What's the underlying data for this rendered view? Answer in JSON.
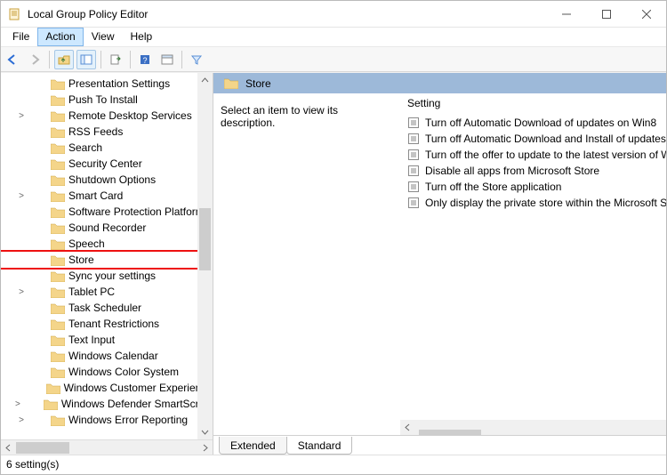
{
  "window": {
    "title": "Local Group Policy Editor"
  },
  "menu": {
    "file": "File",
    "action": "Action",
    "view": "View",
    "help": "Help"
  },
  "tree": {
    "items": [
      {
        "label": "Presentation Settings",
        "expand": ""
      },
      {
        "label": "Push To Install",
        "expand": ""
      },
      {
        "label": "Remote Desktop Services",
        "expand": ">"
      },
      {
        "label": "RSS Feeds",
        "expand": ""
      },
      {
        "label": "Search",
        "expand": ""
      },
      {
        "label": "Security Center",
        "expand": ""
      },
      {
        "label": "Shutdown Options",
        "expand": ""
      },
      {
        "label": "Smart Card",
        "expand": ">"
      },
      {
        "label": "Software Protection Platform",
        "expand": ""
      },
      {
        "label": "Sound Recorder",
        "expand": ""
      },
      {
        "label": "Speech",
        "expand": ""
      },
      {
        "label": "Store",
        "expand": "",
        "highlight": true
      },
      {
        "label": "Sync your settings",
        "expand": ""
      },
      {
        "label": "Tablet PC",
        "expand": ">"
      },
      {
        "label": "Task Scheduler",
        "expand": ""
      },
      {
        "label": "Tenant Restrictions",
        "expand": ""
      },
      {
        "label": "Text Input",
        "expand": ""
      },
      {
        "label": "Windows Calendar",
        "expand": ""
      },
      {
        "label": "Windows Color System",
        "expand": ""
      },
      {
        "label": "Windows Customer Experience",
        "expand": ""
      },
      {
        "label": "Windows Defender SmartScreen",
        "expand": ">"
      },
      {
        "label": "Windows Error Reporting",
        "expand": ">"
      }
    ]
  },
  "right": {
    "header": "Store",
    "description": "Select an item to view its description.",
    "column": "Setting",
    "settings": [
      "Turn off Automatic Download of updates on Win8",
      "Turn off Automatic Download and Install of updates",
      "Turn off the offer to update to the latest version of Windows",
      "Disable all apps from Microsoft Store",
      "Turn off the Store application",
      "Only display the private store within the Microsoft Store"
    ]
  },
  "tabs": {
    "extended": "Extended",
    "standard": "Standard"
  },
  "status": "6 setting(s)"
}
